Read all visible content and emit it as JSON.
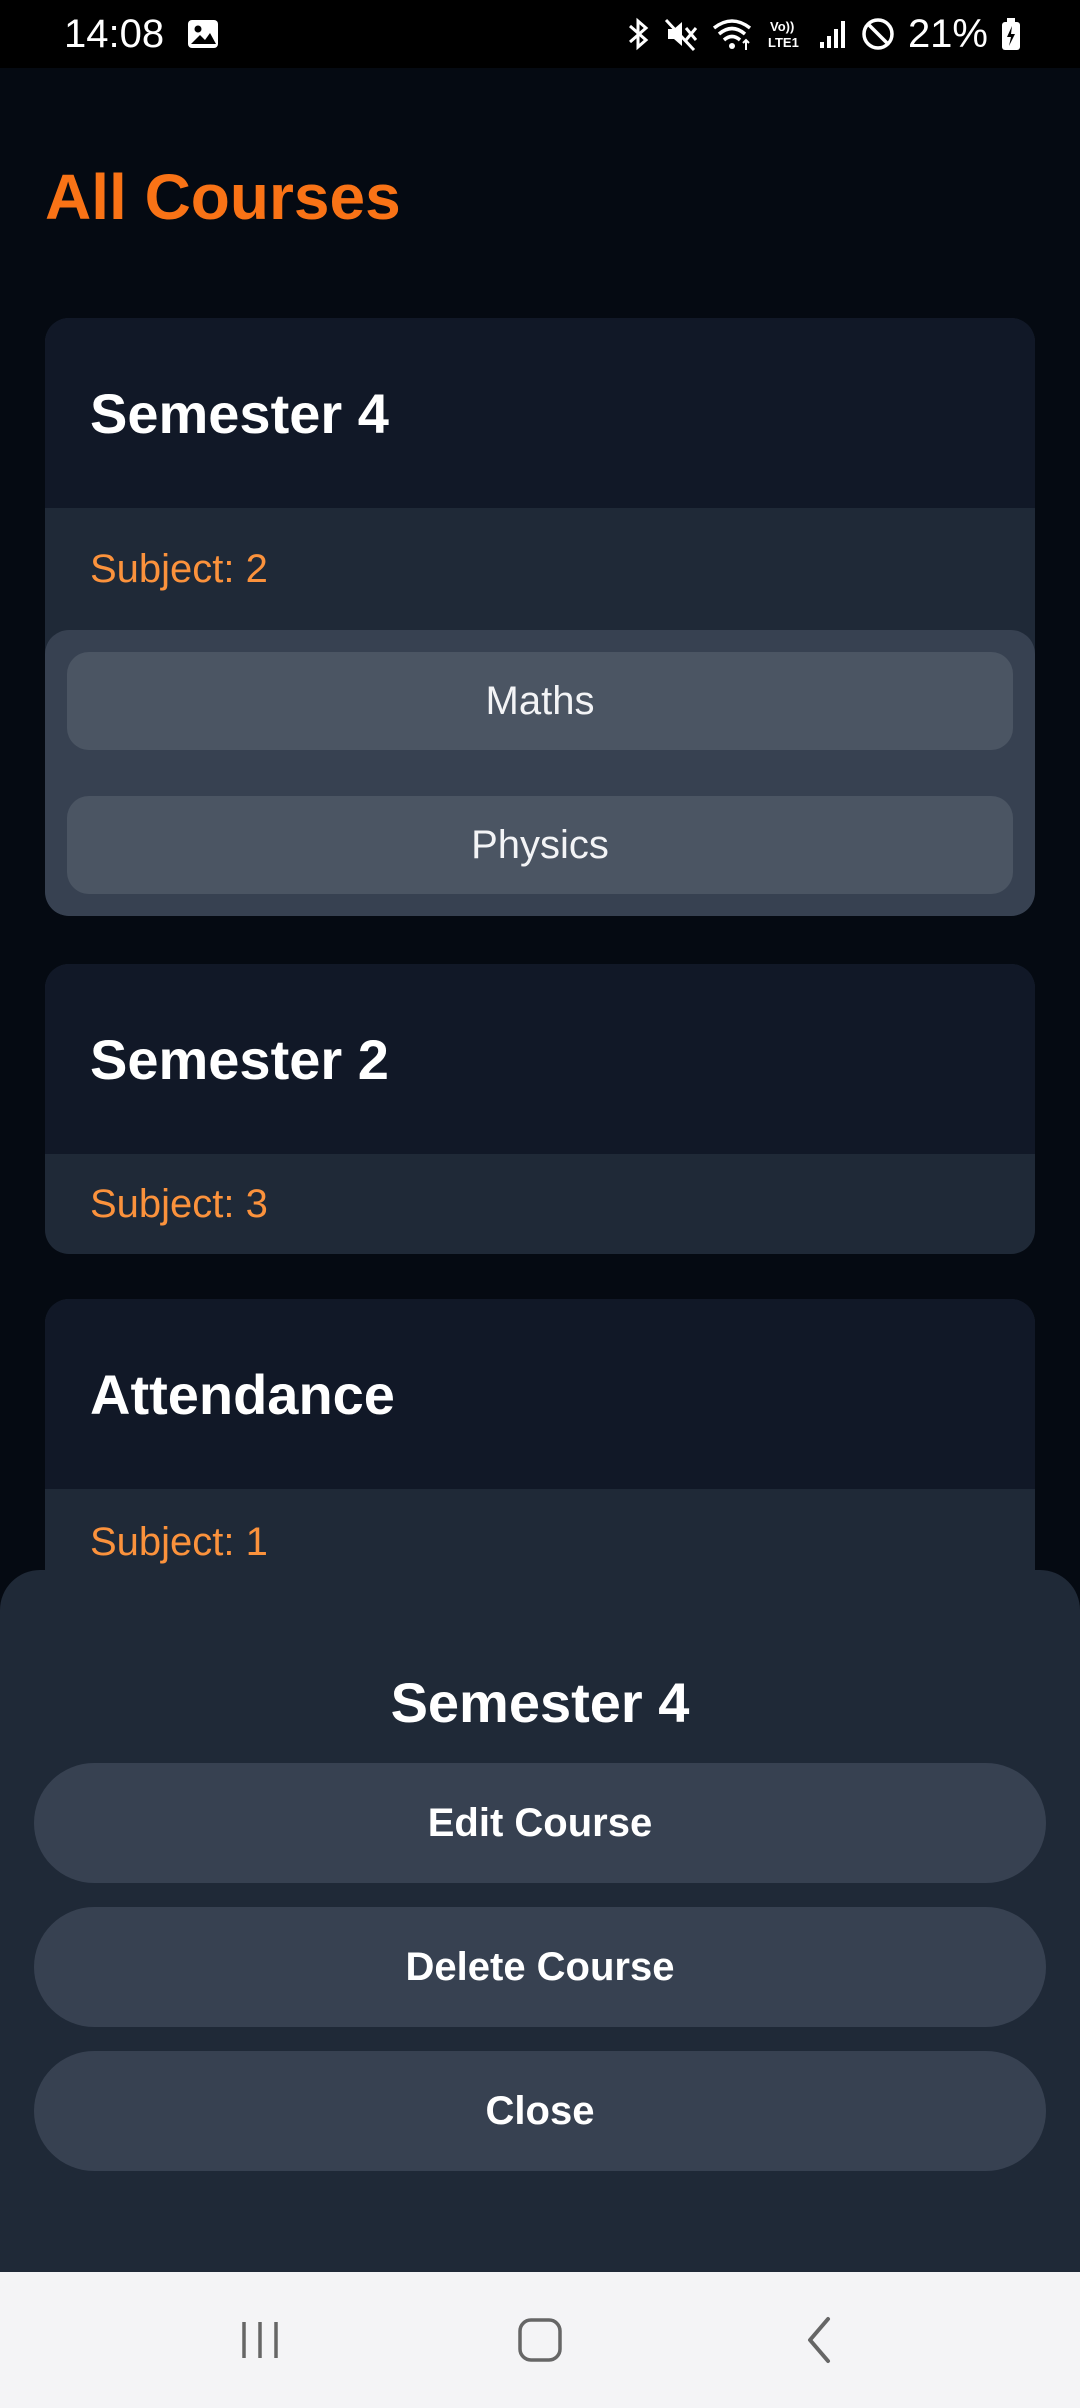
{
  "status_bar": {
    "time": "14:08",
    "battery": "21%",
    "icons": [
      "image-icon",
      "bluetooth-icon",
      "mute-icon",
      "wifi-icon",
      "volte-icon",
      "signal-icon",
      "do-not-disturb-icon",
      "battery-icon"
    ]
  },
  "header": {
    "title": "All Courses"
  },
  "courses": [
    {
      "title": "Semester 4",
      "subject_count": "Subject: 2",
      "subjects": [
        "Maths",
        "Physics"
      ]
    },
    {
      "title": "Semester 2",
      "subject_count": "Subject: 3"
    },
    {
      "title": "Attendance",
      "subject_count": "Subject: 1"
    }
  ],
  "sheet": {
    "title": "Semester 4",
    "edit_label": "Edit Course",
    "delete_label": "Delete Course",
    "close_label": "Close"
  },
  "nav": {
    "icons": [
      "recent-apps-icon",
      "home-icon",
      "back-icon"
    ]
  },
  "colors": {
    "accent": "#f97316",
    "background": "#050a12",
    "card": "#1f2937",
    "card_header": "#111827"
  }
}
